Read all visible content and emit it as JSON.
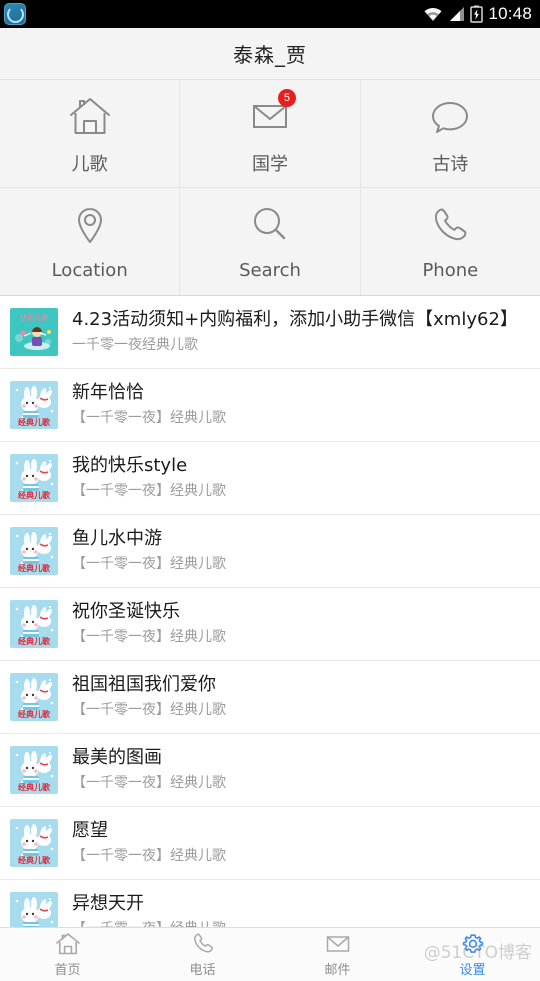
{
  "status_bar": {
    "app_icon": "app-logo-icon",
    "wifi_icon": "wifi-icon",
    "signal_icon": "cellular-signal-icon",
    "battery_icon": "battery-charging-icon",
    "time": "10:48"
  },
  "header": {
    "title": "泰森_贾"
  },
  "grid": {
    "items": [
      {
        "label": "儿歌",
        "icon": "home-icon",
        "badge": ""
      },
      {
        "label": "国学",
        "icon": "mail-icon",
        "badge": "5"
      },
      {
        "label": "古诗",
        "icon": "chat-icon",
        "badge": ""
      },
      {
        "label": "Location",
        "icon": "location-pin-icon",
        "badge": ""
      },
      {
        "label": "Search",
        "icon": "search-icon",
        "badge": ""
      },
      {
        "label": "Phone",
        "icon": "phone-icon",
        "badge": ""
      }
    ]
  },
  "list": {
    "items": [
      {
        "title": "4.23活动须知+内购福利，添加小助手微信【xmly62】",
        "subtitle": "一千零一夜经典儿歌",
        "thumb": "kids-song-cover"
      },
      {
        "title": "新年恰恰",
        "subtitle": "【一千零一夜】经典儿歌",
        "thumb": "rabbit-cover"
      },
      {
        "title": "我的快乐style",
        "subtitle": "【一千零一夜】经典儿歌",
        "thumb": "rabbit-cover"
      },
      {
        "title": "鱼儿水中游",
        "subtitle": "【一千零一夜】经典儿歌",
        "thumb": "rabbit-cover"
      },
      {
        "title": "祝你圣诞快乐",
        "subtitle": "【一千零一夜】经典儿歌",
        "thumb": "rabbit-cover"
      },
      {
        "title": "祖国祖国我们爱你",
        "subtitle": "【一千零一夜】经典儿歌",
        "thumb": "rabbit-cover"
      },
      {
        "title": "最美的图画",
        "subtitle": "【一千零一夜】经典儿歌",
        "thumb": "rabbit-cover"
      },
      {
        "title": "愿望",
        "subtitle": "【一千零一夜】经典儿歌",
        "thumb": "rabbit-cover"
      },
      {
        "title": "异想天开",
        "subtitle": "【一千零一夜】经典儿歌",
        "thumb": "rabbit-cover"
      }
    ]
  },
  "tabbar": {
    "items": [
      {
        "label": "首页",
        "icon": "home-icon",
        "active": false
      },
      {
        "label": "电话",
        "icon": "phone-icon",
        "active": false
      },
      {
        "label": "邮件",
        "icon": "mail-icon",
        "active": false
      },
      {
        "label": "设置",
        "icon": "gear-icon",
        "active": true
      }
    ]
  },
  "watermark": {
    "text": "@51CTO博客"
  },
  "colors": {
    "accent": "#3b8bf0",
    "badge": "#e81f1f",
    "header_bg": "#f4f4f4",
    "thumb_blue": "#a6dced",
    "thumb_teal": "#3fc6c0"
  }
}
